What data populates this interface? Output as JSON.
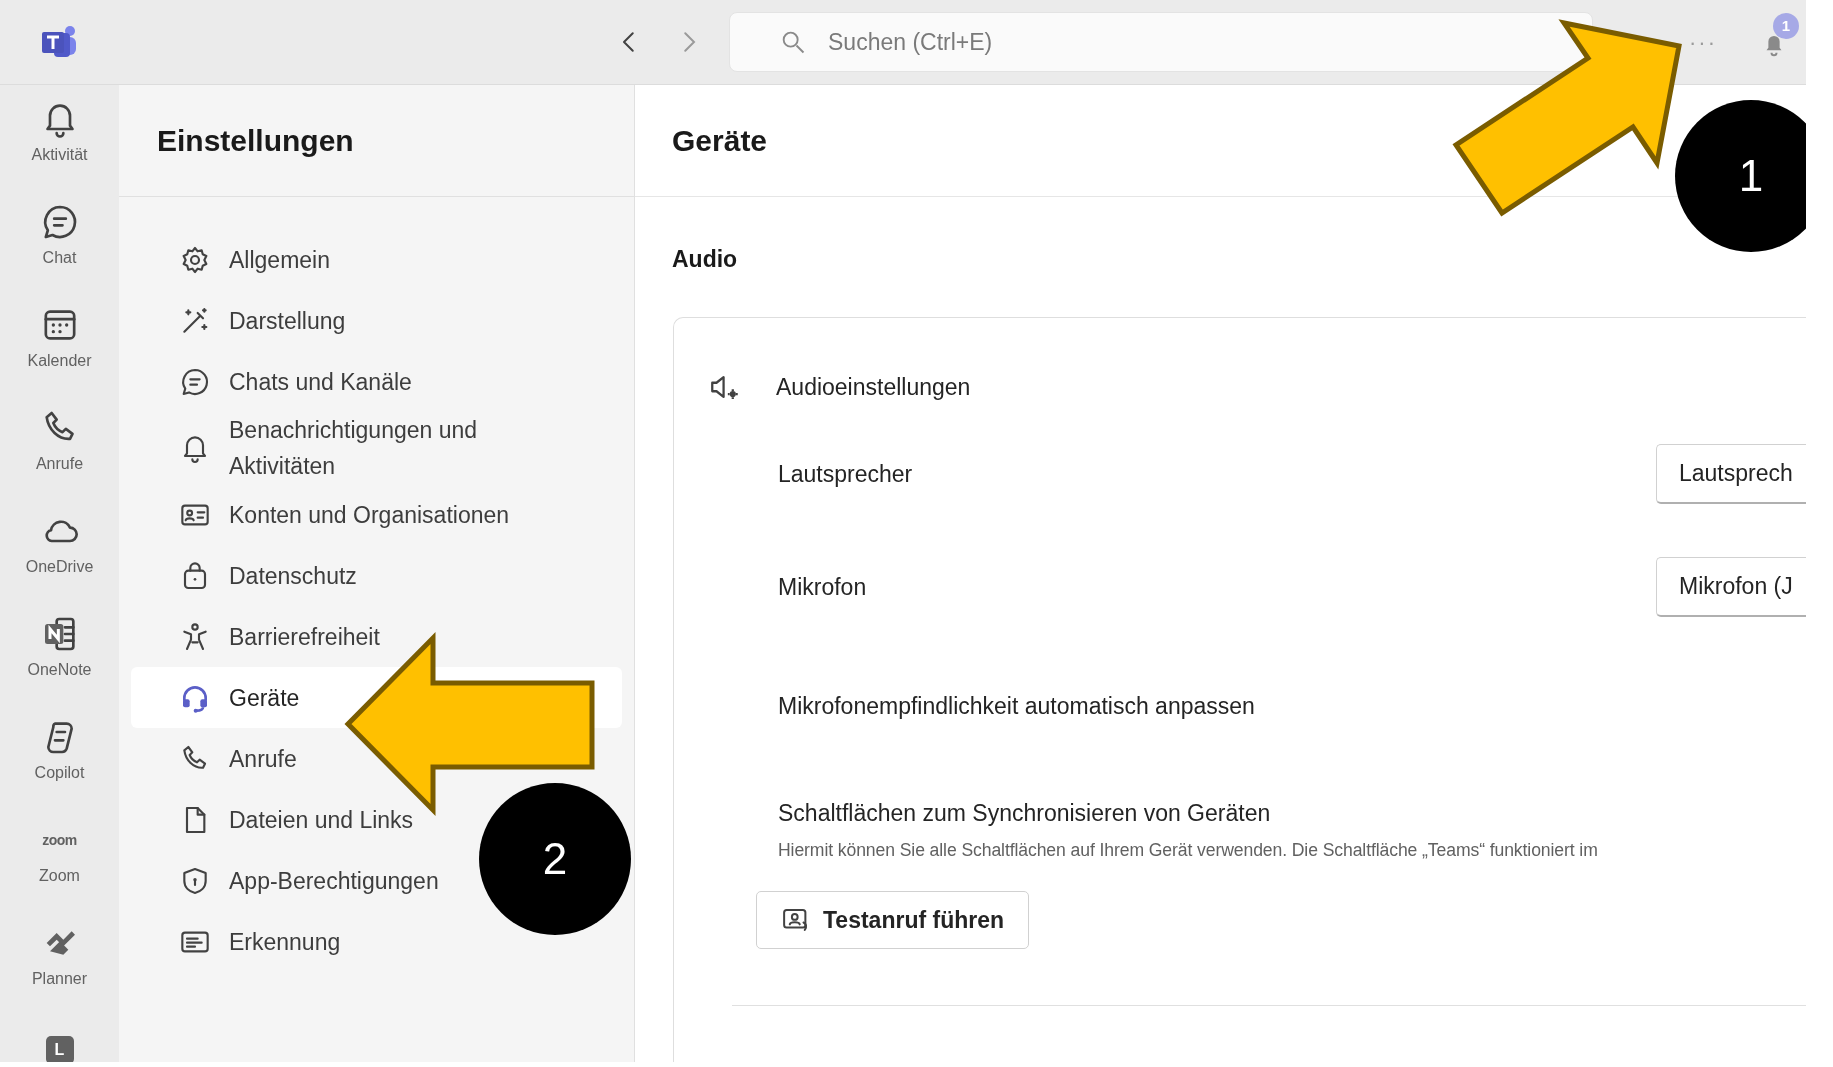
{
  "top_bar": {
    "search": {
      "placeholder": "Suchen (Ctrl+E)"
    },
    "more": "···",
    "notification_badge": "1"
  },
  "rail": [
    {
      "kind": "icon",
      "label": "Aktivität"
    },
    {
      "kind": "icon",
      "label": "Chat"
    },
    {
      "kind": "icon",
      "label": "Kalender"
    },
    {
      "kind": "icon",
      "label": "Anrufe"
    },
    {
      "kind": "icon",
      "label": "OneDrive"
    },
    {
      "kind": "icon",
      "label": "OneNote"
    },
    {
      "kind": "icon",
      "label": "Copilot"
    },
    {
      "kind": "logo",
      "logo_text": "zoom",
      "label": "Zoom"
    },
    {
      "kind": "icon",
      "label": "Planner"
    },
    {
      "kind": "tile",
      "glyph": "L"
    }
  ],
  "settings": {
    "title": "Einstellungen",
    "items": [
      {
        "label": "Allgemein",
        "selected": false
      },
      {
        "label": "Darstellung",
        "selected": false
      },
      {
        "label": "Chats und Kanäle",
        "selected": false
      },
      {
        "label": "Benachrichtigungen und Aktivitäten",
        "selected": false
      },
      {
        "label": "Konten und Organisationen",
        "selected": false
      },
      {
        "label": "Datenschutz",
        "selected": false
      },
      {
        "label": "Barrierefreiheit",
        "selected": false
      },
      {
        "label": "Geräte",
        "selected": true
      },
      {
        "label": "Anrufe",
        "selected": false
      },
      {
        "label": "Dateien und Links",
        "selected": false
      },
      {
        "label": "App-Berechtigungen",
        "selected": false
      },
      {
        "label": "Erkennung",
        "selected": false
      }
    ]
  },
  "content": {
    "title": "Geräte",
    "section": "Audio",
    "card": {
      "heading": "Audioeinstellungen",
      "rows": [
        {
          "kind": "dropdown",
          "label": "Lautsprecher",
          "value": "Lautsprech"
        },
        {
          "kind": "dropdown",
          "label": "Mikrofon",
          "value": "Mikrofon (J"
        },
        {
          "kind": "plain",
          "label": "Mikrofonempfindlichkeit automatisch anpassen"
        },
        {
          "kind": "described",
          "label": "Schaltflächen zum Synchronisieren von Geräten",
          "description": "Hiermit können Sie alle Schaltflächen auf Ihrem Gerät verwenden. Die Schaltfläche „Teams“ funktioniert im"
        }
      ],
      "button": "Testanruf führen"
    }
  },
  "annotations": [
    {
      "number": "1"
    },
    {
      "number": "2"
    }
  ]
}
